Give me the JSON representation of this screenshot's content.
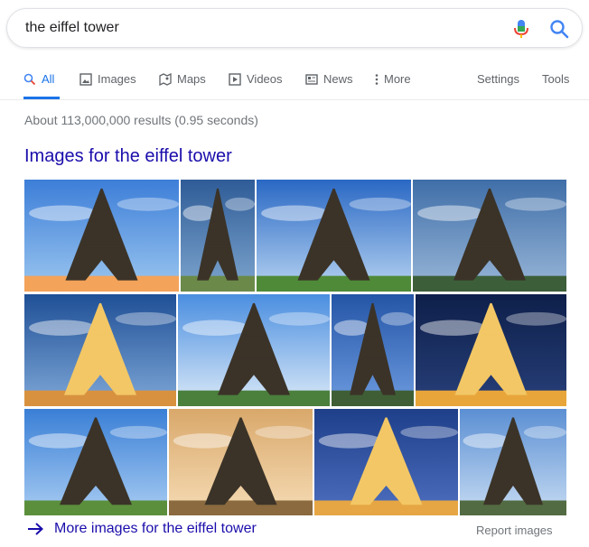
{
  "search": {
    "query": "the eiffel tower"
  },
  "tabs": [
    {
      "label": "All"
    },
    {
      "label": "Images"
    },
    {
      "label": "Maps"
    },
    {
      "label": "Videos"
    },
    {
      "label": "News"
    },
    {
      "label": "More"
    }
  ],
  "tools": {
    "settings": "Settings",
    "tools": "Tools"
  },
  "results_stats": "About 113,000,000 results (0.95 seconds)",
  "images_section": {
    "title": "Images for the eiffel tower",
    "more_link": "More images for the eiffel tower",
    "report": "Report images"
  },
  "colors": {
    "accent": "#1a73e8",
    "link": "#1a0dab",
    "muted": "#70757a",
    "mic_red": "#ea4335"
  }
}
